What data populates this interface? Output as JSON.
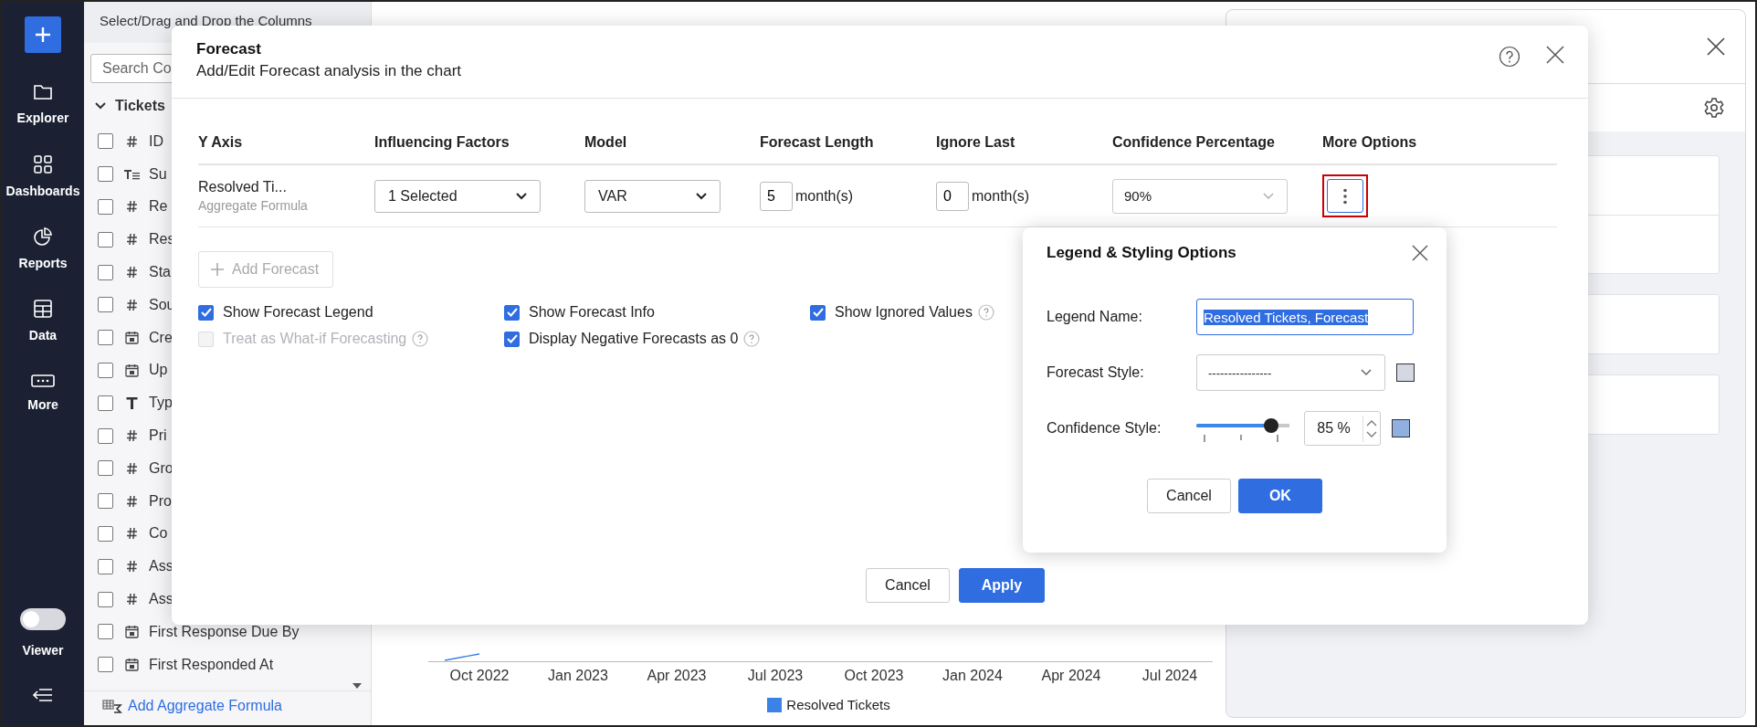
{
  "nav": {
    "items": [
      {
        "label": "Explorer",
        "kind": "folder"
      },
      {
        "label": "Dashboards",
        "kind": "grid"
      },
      {
        "label": "Reports",
        "kind": "pie"
      },
      {
        "label": "Data",
        "kind": "table"
      },
      {
        "label": "More",
        "kind": "more"
      }
    ],
    "toggle": {
      "label": "Viewer",
      "on": false
    }
  },
  "columns_panel": {
    "title": "Select/Drag and Drop the Columns",
    "search": {
      "placeholder": "Search Co"
    },
    "tree": [
      {
        "label": "Tickets",
        "expanded": true,
        "children": [
          {
            "label": "ID",
            "kind": "number",
            "checked": false
          },
          {
            "label": "Su",
            "kind": "text",
            "checked": false
          },
          {
            "label": "Re",
            "kind": "number",
            "checked": false
          },
          {
            "label": "Res",
            "kind": "number",
            "checked": false
          },
          {
            "label": "Sta",
            "kind": "number",
            "checked": false
          },
          {
            "label": "Sou",
            "kind": "number",
            "checked": false
          },
          {
            "label": "Cre",
            "kind": "date",
            "checked": false
          },
          {
            "label": "Up",
            "kind": "date",
            "checked": false
          },
          {
            "label": "Typ",
            "kind": "letter",
            "checked": false
          },
          {
            "label": "Pri",
            "kind": "number",
            "checked": false
          },
          {
            "label": "Gro",
            "kind": "number",
            "checked": false
          },
          {
            "label": "Pro",
            "kind": "number",
            "checked": false
          },
          {
            "label": "Co",
            "kind": "number",
            "checked": false
          },
          {
            "label": "Ass",
            "kind": "number",
            "checked": false
          },
          {
            "label": "Ass",
            "kind": "number",
            "checked": false
          },
          {
            "label": "First Response Due By",
            "kind": "date",
            "checked": false
          },
          {
            "label": "First Responded At",
            "kind": "date",
            "checked": false
          }
        ]
      }
    ],
    "add_link": "Add Aggregate Formula"
  },
  "chart": {
    "x_labels": [
      "Oct 2022",
      "Jan 2023",
      "Apr 2023",
      "Jul 2023",
      "Oct 2023",
      "Jan 2024",
      "Apr 2024",
      "Jul 2024"
    ],
    "legend": "Resolved Tickets"
  },
  "forecast_dialog": {
    "title": "Forecast",
    "subtitle": "Add/Edit Forecast analysis in the chart",
    "columns": [
      "Y Axis",
      "Influencing Factors",
      "Model",
      "Forecast Length",
      "Ignore Last",
      "Confidence Percentage",
      "More Options"
    ],
    "rows": [
      {
        "y_axis": "Resolved Ti...",
        "y_axis_note": "Aggregate Formula",
        "influencing_factors": "1 Selected",
        "model": "VAR",
        "forecast_length": "5",
        "forecast_length_unit": "month(s)",
        "ignore_last": "0",
        "ignore_last_unit": "month(s)",
        "confidence": "90%",
        "more_selected": true
      }
    ],
    "add_forecast": {
      "label": "Add Forecast",
      "disabled": true
    },
    "options": [
      {
        "label": "Show Forecast Legend",
        "checked": true,
        "disabled": false,
        "help": false
      },
      {
        "label": "Show Forecast Info",
        "checked": true,
        "disabled": false,
        "help": false
      },
      {
        "label": "Show Ignored Values",
        "checked": true,
        "disabled": false,
        "help": true
      },
      {
        "label": "Treat as What-if Forecasting",
        "checked": false,
        "disabled": true,
        "help": true
      },
      {
        "label": "Display Negative Forecasts as 0",
        "checked": true,
        "disabled": false,
        "help": true
      }
    ],
    "cancel": "Cancel",
    "apply": "Apply"
  },
  "legend_popover": {
    "title": "Legend & Styling Options",
    "legend_name": {
      "label": "Legend Name:",
      "value": "Resolved Tickets, Forecast"
    },
    "forecast_style": {
      "label": "Forecast Style:",
      "value": "----------------",
      "color": "#d3d8e2"
    },
    "confidence_style": {
      "label": "Confidence Style:",
      "level": 0.8,
      "value": "85 %",
      "color": "#8fb0e0"
    },
    "cancel": "Cancel",
    "ok": "OK"
  }
}
